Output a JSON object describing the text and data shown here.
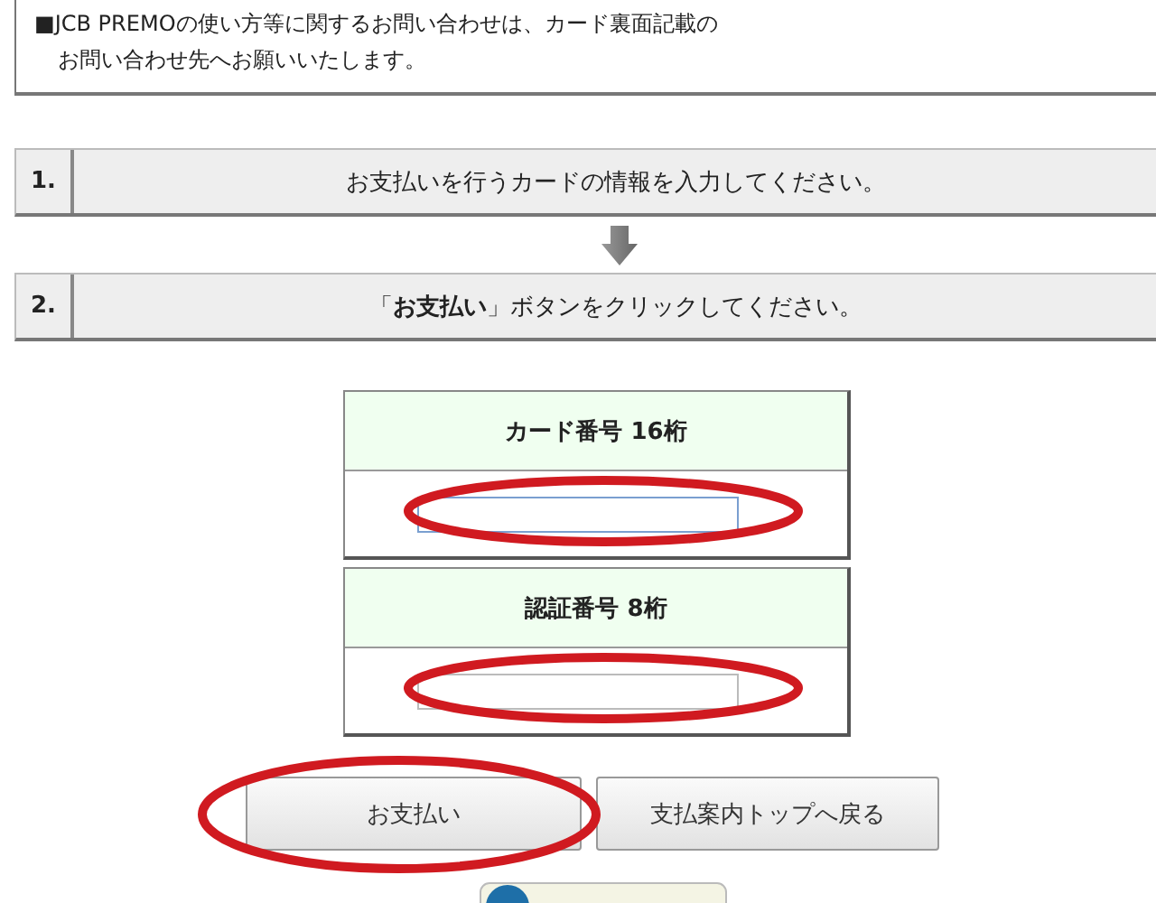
{
  "notice": {
    "lines": [
      "■JCB PREMOの使い方等に関するお問い合わせは、カード裏面記載の",
      "お問い合わせ先へお願いいたします。"
    ]
  },
  "steps": [
    {
      "number": "1.",
      "text": "お支払いを行うカードの情報を入力してください。"
    },
    {
      "number": "2.",
      "text": "「**お支払い**」ボタンをクリックしてください。"
    }
  ],
  "fields": [
    {
      "label": "カード番号 16桁",
      "focused": true,
      "circled": true
    },
    {
      "label": "認証番号 8桁",
      "focused": false,
      "circled": true
    }
  ],
  "buttons": [
    {
      "label": "お支払い",
      "circled": true
    },
    {
      "label": "支払案内トップへ戻る",
      "circled": false
    }
  ]
}
